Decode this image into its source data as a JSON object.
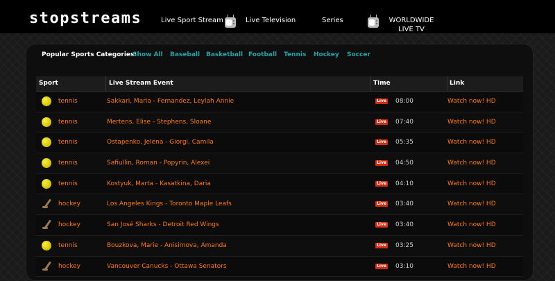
{
  "header": {
    "logo": "stopstreams",
    "nav": [
      {
        "label": "Live Sport Stream",
        "icon": "none"
      },
      {
        "label": "Live Television",
        "icon": "tv-icon"
      },
      {
        "label": "Series",
        "icon": "none"
      },
      {
        "label": "WORLDWIDE LIVE TV",
        "icon": "tv-icon"
      }
    ]
  },
  "categories": {
    "label": "Popular Sports Categories:",
    "items": [
      "Show All",
      "Baseball",
      "Basketball",
      "Football",
      "Tennis",
      "Hockey",
      "Soccer"
    ]
  },
  "table": {
    "headers": [
      "Sport",
      "Live Stream Event",
      "Time",
      "Link"
    ],
    "live_badge": "Live",
    "rows": [
      {
        "sport": "tennis",
        "icon": "tennis-ball-icon",
        "event": "Sakkari, Maria - Fernandez, Leylah Annie",
        "time": "08:00",
        "link": "Watch now! HD"
      },
      {
        "sport": "tennis",
        "icon": "tennis-ball-icon",
        "event": "Mertens, Elise - Stephens, Sloane",
        "time": "07:40",
        "link": "Watch now! HD"
      },
      {
        "sport": "tennis",
        "icon": "tennis-ball-icon",
        "event": "Ostapenko, Jelena - Giorgi, Camila",
        "time": "05:35",
        "link": "Watch now! HD"
      },
      {
        "sport": "tennis",
        "icon": "tennis-ball-icon",
        "event": "Safiullin, Roman - Popyrin, Alexei",
        "time": "04:50",
        "link": "Watch now! HD"
      },
      {
        "sport": "tennis",
        "icon": "tennis-ball-icon",
        "event": "Kostyuk, Marta - Kasatkina, Daria",
        "time": "04:10",
        "link": "Watch now! HD"
      },
      {
        "sport": "hockey",
        "icon": "hockey-stick-icon",
        "event": "Los Angeles Kings - Toronto Maple Leafs",
        "time": "03:40",
        "link": "Watch now! HD"
      },
      {
        "sport": "hockey",
        "icon": "hockey-stick-icon",
        "event": "San José Sharks - Detroit Red Wings",
        "time": "03:40",
        "link": "Watch now! HD"
      },
      {
        "sport": "tennis",
        "icon": "tennis-ball-icon",
        "event": "Bouzkova, Marie - Anisimova, Amanda",
        "time": "03:25",
        "link": "Watch now! HD"
      },
      {
        "sport": "hockey",
        "icon": "hockey-stick-icon",
        "event": "Vancouver Canucks - Ottawa Senators",
        "time": "03:10",
        "link": "Watch now! HD"
      }
    ]
  },
  "colors": {
    "accent_link": "#ff7a21",
    "category_link": "#2aa3a8",
    "live_badge": "#d22d12"
  }
}
